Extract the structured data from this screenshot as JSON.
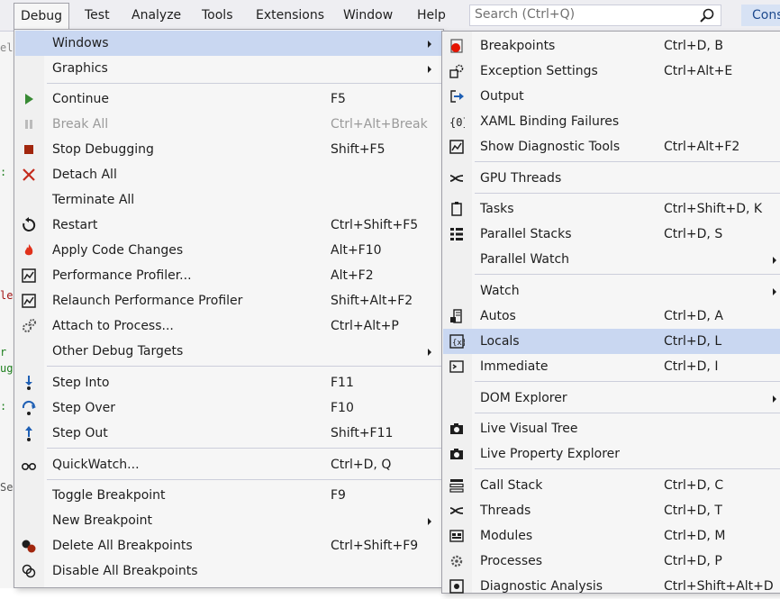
{
  "menubar": {
    "items": [
      "Debug",
      "Test",
      "Analyze",
      "Tools",
      "Extensions",
      "Window",
      "Help"
    ],
    "search_placeholder": "Search (Ctrl+Q)",
    "cons_label": "Cons"
  },
  "debug_menu": {
    "items": [
      {
        "label": "Windows",
        "shortcut": ""
      },
      {
        "label": "Graphics",
        "shortcut": ""
      },
      {
        "label": "Continue",
        "shortcut": "F5"
      },
      {
        "label": "Break All",
        "shortcut": "Ctrl+Alt+Break"
      },
      {
        "label": "Stop Debugging",
        "shortcut": "Shift+F5"
      },
      {
        "label": "Detach All",
        "shortcut": ""
      },
      {
        "label": "Terminate All",
        "shortcut": ""
      },
      {
        "label": "Restart",
        "shortcut": "Ctrl+Shift+F5"
      },
      {
        "label": "Apply Code Changes",
        "shortcut": "Alt+F10"
      },
      {
        "label": "Performance Profiler...",
        "shortcut": "Alt+F2"
      },
      {
        "label": "Relaunch Performance Profiler",
        "shortcut": "Shift+Alt+F2"
      },
      {
        "label": "Attach to Process...",
        "shortcut": "Ctrl+Alt+P"
      },
      {
        "label": "Other Debug Targets",
        "shortcut": ""
      },
      {
        "label": "Step Into",
        "shortcut": "F11"
      },
      {
        "label": "Step Over",
        "shortcut": "F10"
      },
      {
        "label": "Step Out",
        "shortcut": "Shift+F11"
      },
      {
        "label": "QuickWatch...",
        "shortcut": "Ctrl+D, Q"
      },
      {
        "label": "Toggle Breakpoint",
        "shortcut": "F9"
      },
      {
        "label": "New Breakpoint",
        "shortcut": ""
      },
      {
        "label": "Delete All Breakpoints",
        "shortcut": "Ctrl+Shift+F9"
      },
      {
        "label": "Disable All Breakpoints",
        "shortcut": ""
      }
    ]
  },
  "windows_menu": {
    "items": [
      {
        "label": "Breakpoints",
        "shortcut": "Ctrl+D, B"
      },
      {
        "label": "Exception Settings",
        "shortcut": "Ctrl+Alt+E"
      },
      {
        "label": "Output",
        "shortcut": ""
      },
      {
        "label": "XAML Binding Failures",
        "shortcut": ""
      },
      {
        "label": "Show Diagnostic Tools",
        "shortcut": "Ctrl+Alt+F2"
      },
      {
        "label": "GPU Threads",
        "shortcut": ""
      },
      {
        "label": "Tasks",
        "shortcut": "Ctrl+Shift+D, K"
      },
      {
        "label": "Parallel Stacks",
        "shortcut": "Ctrl+D, S"
      },
      {
        "label": "Parallel Watch",
        "shortcut": ""
      },
      {
        "label": "Watch",
        "shortcut": ""
      },
      {
        "label": "Autos",
        "shortcut": "Ctrl+D, A"
      },
      {
        "label": "Locals",
        "shortcut": "Ctrl+D, L"
      },
      {
        "label": "Immediate",
        "shortcut": "Ctrl+D, I"
      },
      {
        "label": "DOM Explorer",
        "shortcut": ""
      },
      {
        "label": "Live Visual Tree",
        "shortcut": ""
      },
      {
        "label": "Live Property Explorer",
        "shortcut": ""
      },
      {
        "label": "Call Stack",
        "shortcut": "Ctrl+D, C"
      },
      {
        "label": "Threads",
        "shortcut": "Ctrl+D, T"
      },
      {
        "label": "Modules",
        "shortcut": "Ctrl+D, M"
      },
      {
        "label": "Processes",
        "shortcut": "Ctrl+D, P"
      },
      {
        "label": "Diagnostic Analysis",
        "shortcut": "Ctrl+Shift+Alt+D"
      }
    ]
  },
  "background": {
    "fragments": [
      "el",
      ":",
      "le",
      "r",
      "ug",
      ":",
      "Se"
    ]
  },
  "colors": {
    "menu_bg": "#f6f6f6",
    "highlight": "#c9d7f1",
    "menubar_bg": "#eeeef2",
    "accent": "#1e4a8e"
  }
}
